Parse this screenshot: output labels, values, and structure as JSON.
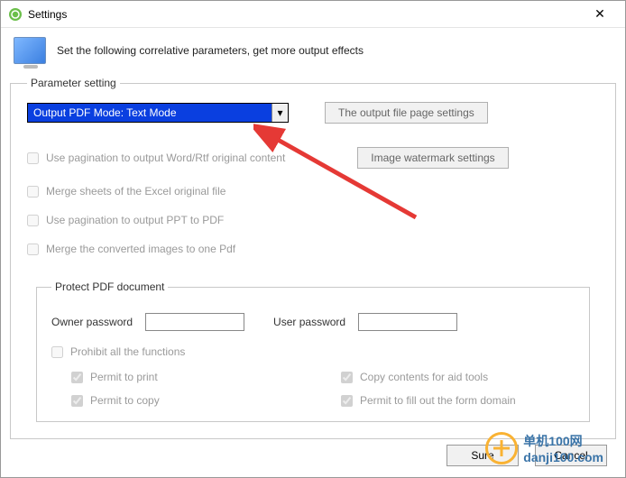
{
  "window": {
    "title": "Settings"
  },
  "header": {
    "desc": "Set the following correlative parameters, get more output effects"
  },
  "fieldset_title": "Parameter setting",
  "dropdown": {
    "selected": "Output PDF Mode: Text Mode"
  },
  "buttons": {
    "page_settings": "The output file page settings",
    "watermark": "Image watermark settings"
  },
  "checks": {
    "pag_word": "Use pagination to output Word/Rtf original content",
    "merge_excel": "Merge sheets of the Excel original file",
    "pag_ppt": "Use pagination to output PPT to PDF",
    "merge_img": "Merge the converted images to one Pdf"
  },
  "protect": {
    "legend": "Protect PDF document",
    "owner_label": "Owner password",
    "user_label": "User password",
    "owner_value": "",
    "user_value": "",
    "prohibit": "Prohibit all the functions",
    "permit_print": "Permit to print",
    "permit_copy": "Permit to copy",
    "permit_copy_aid": "Copy contents for aid tools",
    "permit_form": "Permit to fill out the form domain"
  },
  "footer": {
    "sure": "Sure",
    "cancel": "Cancel"
  },
  "watermark_text": "单机100网\ndanji100.com"
}
